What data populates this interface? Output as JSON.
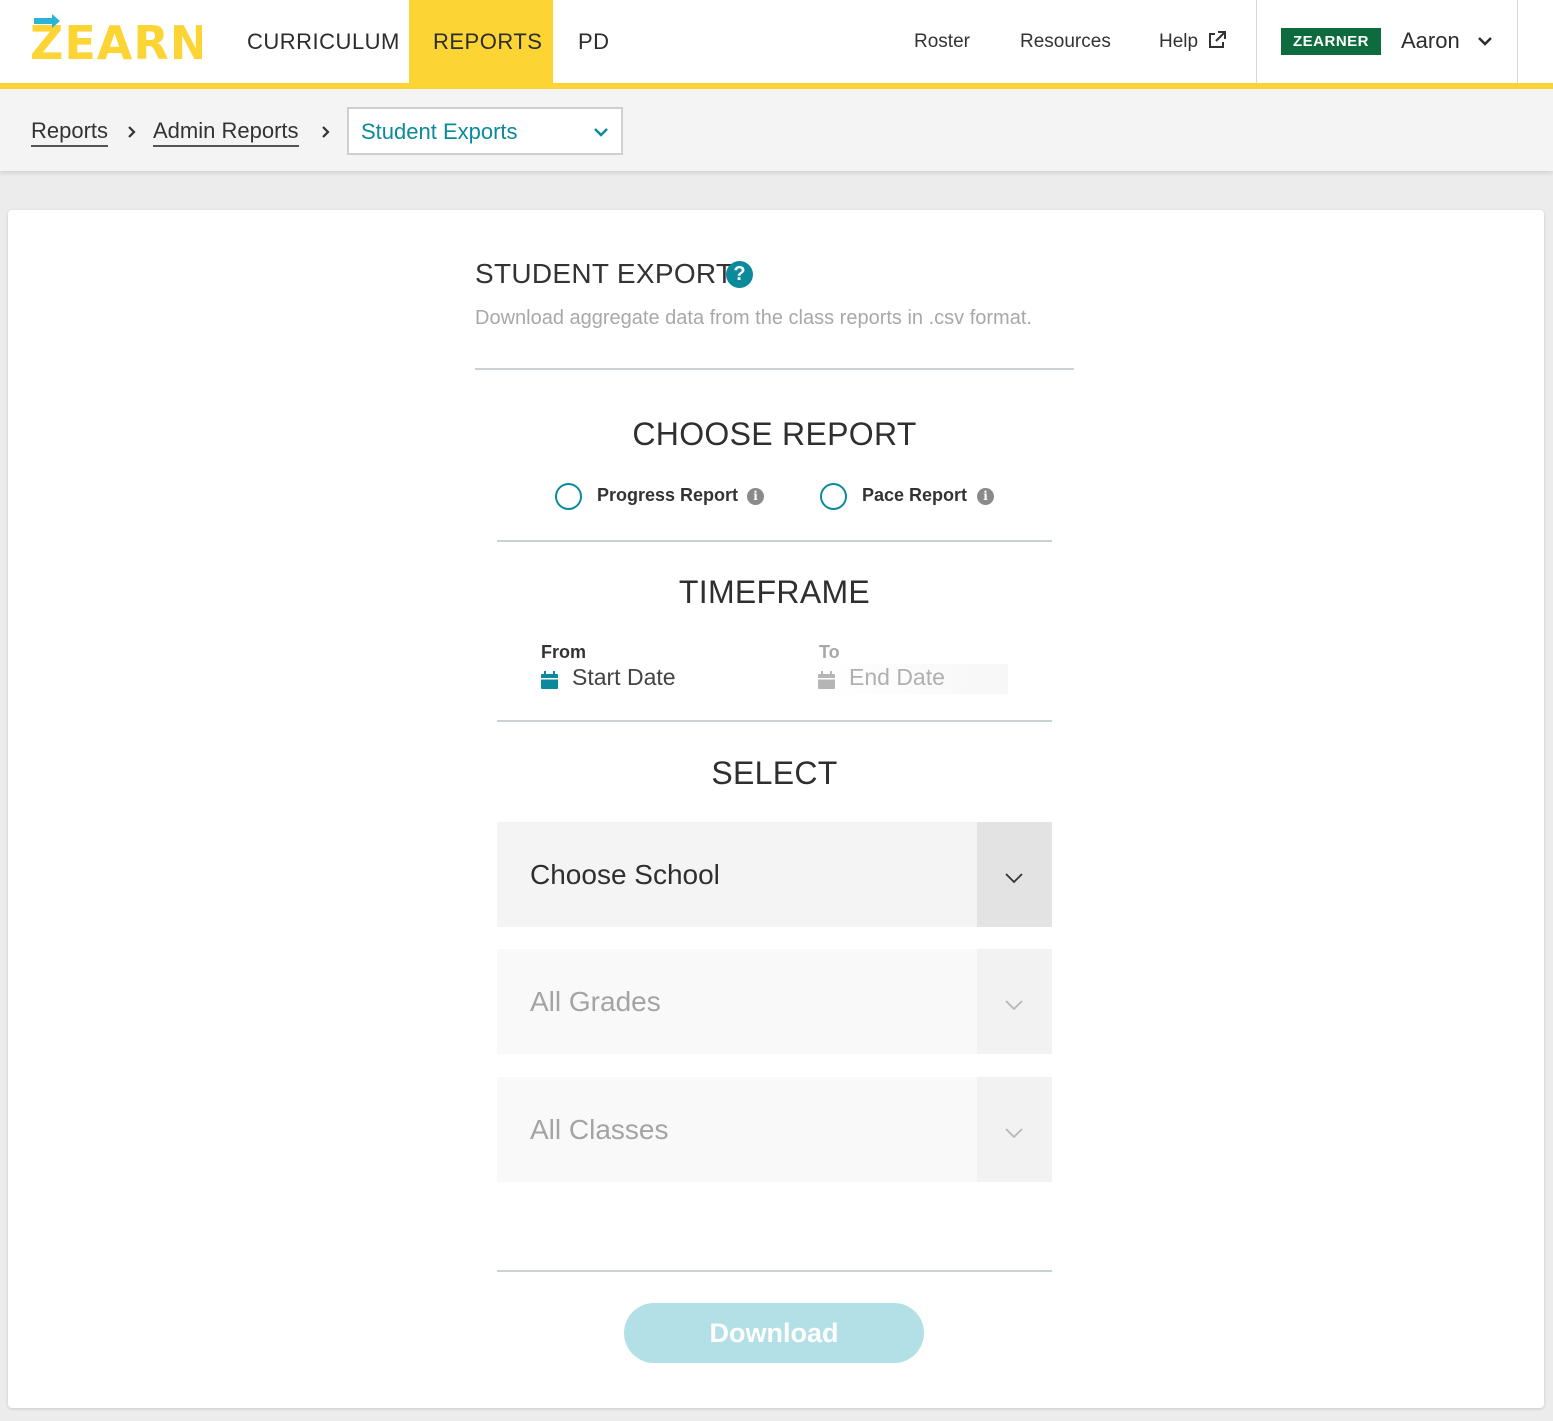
{
  "brand": {
    "name": "ZEARN",
    "primary_color": "#fcd535",
    "accent_color": "#0b8a9c"
  },
  "nav": {
    "tabs": [
      {
        "label": "CURRICULUM"
      },
      {
        "label": "REPORTS",
        "active": true
      },
      {
        "label": "PD"
      }
    ],
    "links": [
      {
        "label": "Roster"
      },
      {
        "label": "Resources"
      },
      {
        "label": "Help",
        "icon": "external-link-icon"
      }
    ],
    "badge": "ZEARNER",
    "user_name": "Aaron"
  },
  "breadcrumb": {
    "items": [
      "Reports",
      "Admin Reports"
    ],
    "current_select": "Student Exports"
  },
  "page": {
    "title": "STUDENT EXPORTS",
    "help_glyph": "?",
    "subtitle": "Download aggregate data from the class reports in .csv format."
  },
  "choose_report": {
    "heading": "CHOOSE REPORT",
    "options": [
      {
        "label": "Progress Report",
        "selected": false
      },
      {
        "label": "Pace Report",
        "selected": false
      }
    ],
    "info_glyph": "i"
  },
  "timeframe": {
    "heading": "TIMEFRAME",
    "from_label": "From",
    "from_placeholder": "Start Date",
    "to_label": "To",
    "to_placeholder": "End Date"
  },
  "select": {
    "heading": "SELECT",
    "school": "Choose School",
    "grades": "All Grades",
    "classes": "All Classes"
  },
  "download_label": "Download"
}
